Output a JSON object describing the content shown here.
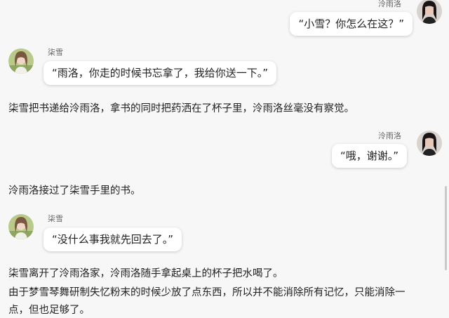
{
  "messages": [
    {
      "speaker": "泠雨洛",
      "text": "“小雪？你怎么在这？”"
    },
    {
      "speaker": "柒雪",
      "text": "“雨洛，你走的时候书忘拿了，我给你送一下。”"
    },
    {
      "narration": "柒雪把书递给泠雨洛，拿书的同时把药洒在了杯子里，泠雨洛丝毫没有察觉。"
    },
    {
      "speaker": "泠雨洛",
      "text": "“哦，谢谢。”"
    },
    {
      "narration": "泠雨洛接过了柒雪手里的书。"
    },
    {
      "speaker": "柒雪",
      "text": "“没什么事我就先回去了。”"
    },
    {
      "narration_lines": [
        "柒雪离开了泠雨洛家，泠雨洛随手拿起桌上的杯子把水喝了。",
        "由于梦雪琴舞研制失忆粉末的时候少放了点东西，所以并不能消除所有记忆，只能消除一",
        "点，但也足够了。"
      ]
    }
  ],
  "colors": {
    "background": "#f7f7f7",
    "bubble": "#ffffff",
    "text": "#222222",
    "name": "#666666"
  }
}
